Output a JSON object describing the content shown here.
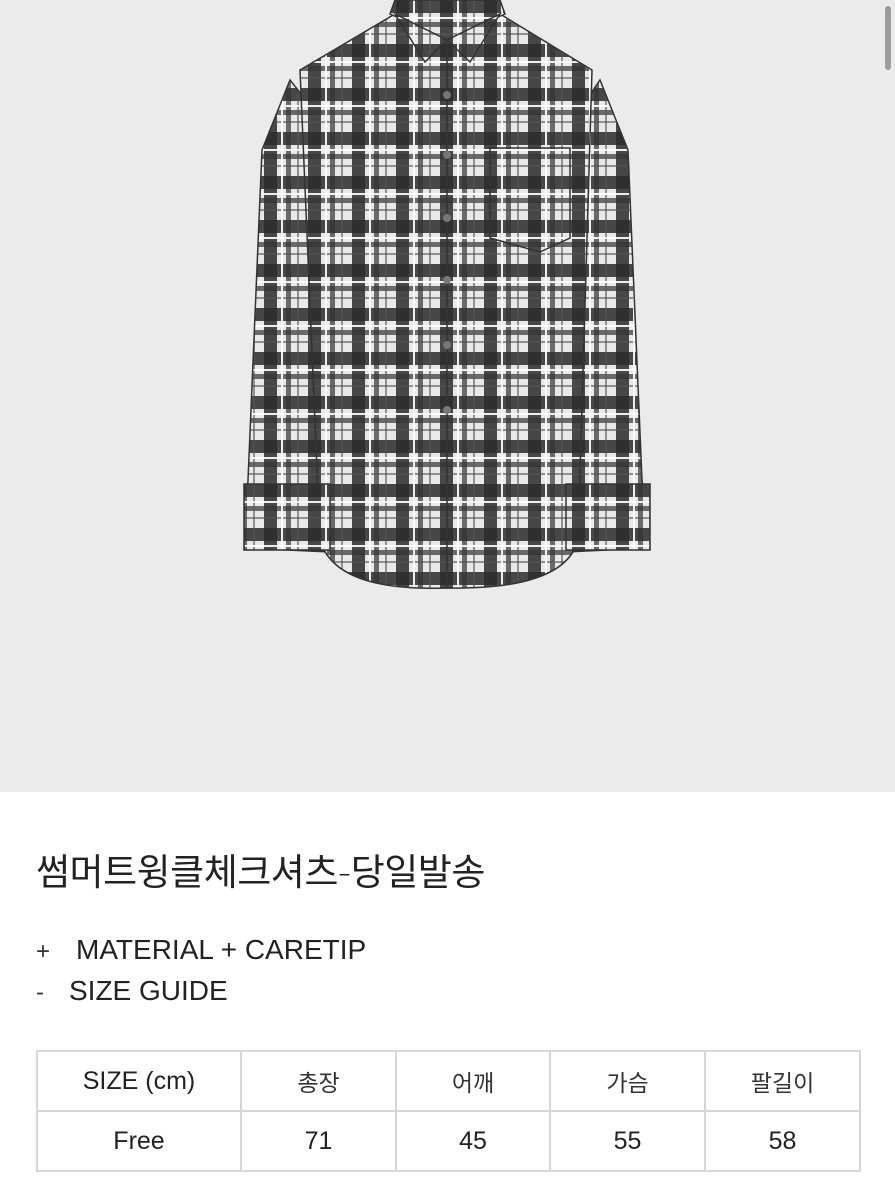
{
  "product": {
    "title": "썸머트윙클체크셔츠-당일발송",
    "image_alt": "plaid check shirt"
  },
  "sections": [
    {
      "symbol": "+",
      "label": "MATERIAL + CARETIP"
    },
    {
      "symbol": "-",
      "label": "SIZE GUIDE"
    }
  ],
  "size_table": {
    "headers": [
      "SIZE (cm)",
      "총장",
      "어깨",
      "가슴",
      "팔길이"
    ],
    "rows": [
      [
        "Free",
        "71",
        "45",
        "55",
        "58"
      ]
    ]
  },
  "colors": {
    "hero_background": "#ebebeb",
    "table_border": "#d7d7d7"
  }
}
